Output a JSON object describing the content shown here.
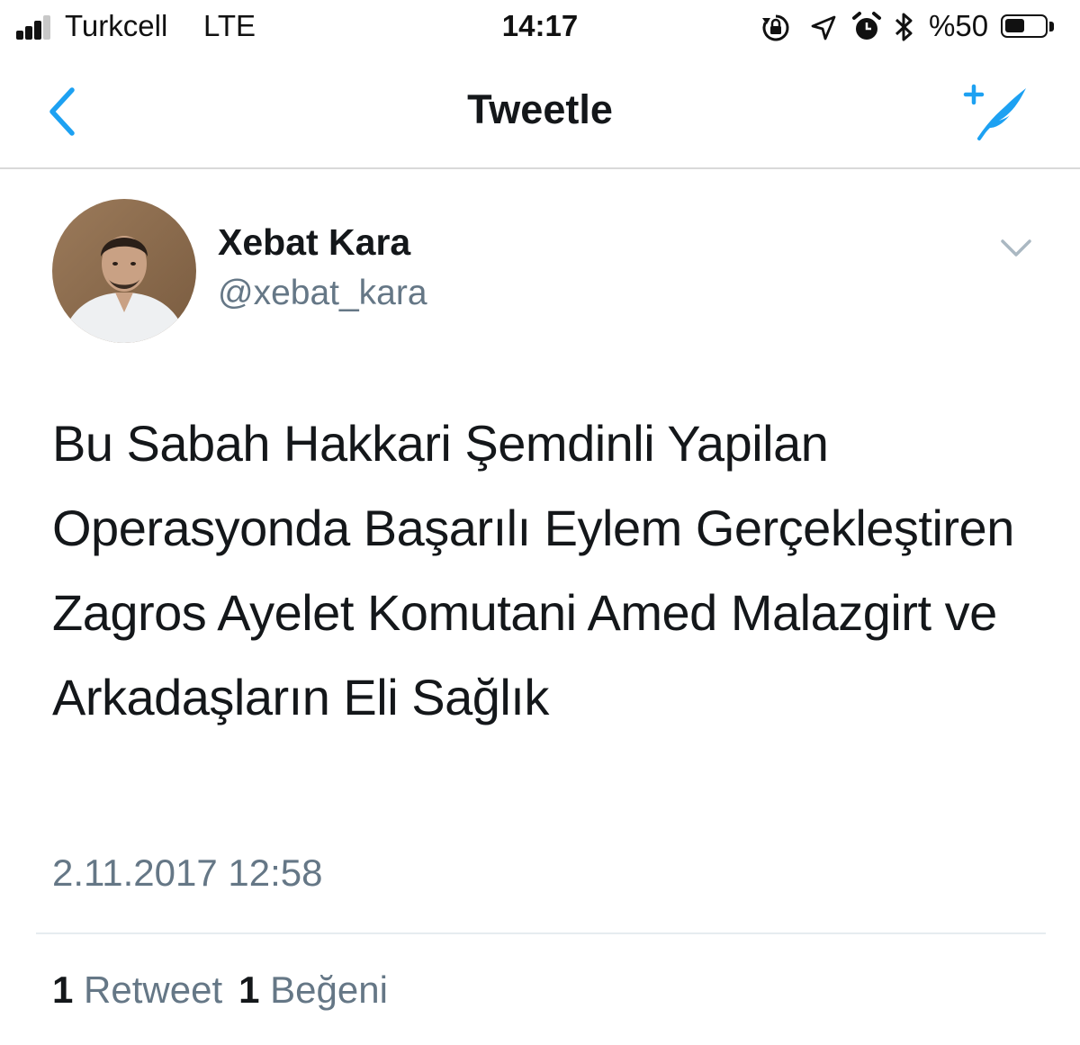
{
  "status_bar": {
    "carrier": "Turkcell",
    "network": "LTE",
    "time": "14:17",
    "battery_text": "%50",
    "battery_level": 0.5,
    "signal_bars": 3,
    "icons": [
      "orientation-lock-icon",
      "location-arrow-icon",
      "alarm-icon",
      "bluetooth-icon"
    ]
  },
  "nav": {
    "title": "Tweetle",
    "back_icon": "chevron-left-icon",
    "compose_icon": "compose-tweet-icon"
  },
  "tweet": {
    "display_name": "Xebat Kara",
    "username": "@xebat_kara",
    "text": "Bu Sabah Hakkari Şemdinli Yapilan Operasyonda Başarılı Eylem Gerçekleştiren Zagros Ayelet Komutani Amed Malazgirt ve Arkadaşların Eli Sağlık",
    "timestamp": "2.11.2017 12:58",
    "retweet_count": "1",
    "retweet_label": "Retweet",
    "like_count": "1",
    "like_label": "Beğeni"
  },
  "colors": {
    "accent": "#1da1f2",
    "text": "#14171a",
    "secondary": "#657786",
    "divider": "#e6ecf0"
  }
}
